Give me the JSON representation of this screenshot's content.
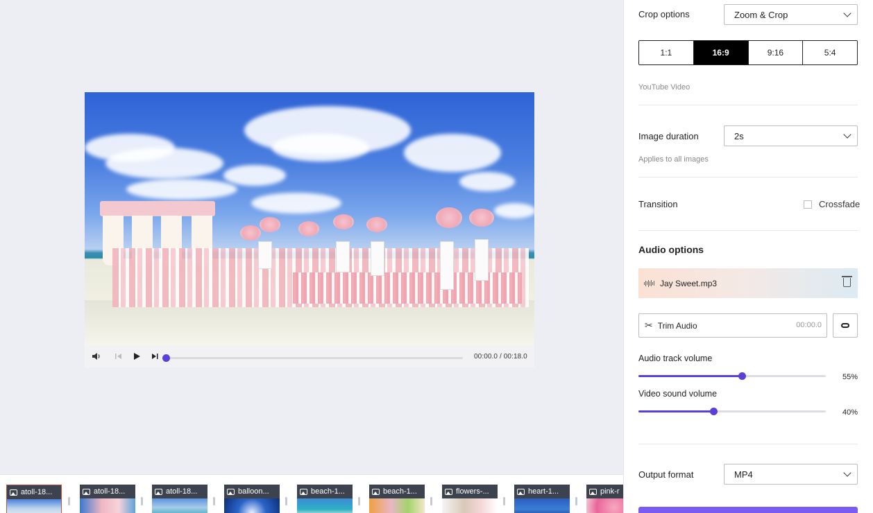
{
  "player": {
    "current_time": "00:00.0",
    "separator": "/",
    "duration": "00:18.0",
    "progress": 0.0
  },
  "filmstrip": {
    "items": [
      {
        "label": "atoll-18...",
        "selected": true
      },
      {
        "label": "atoll-18..."
      },
      {
        "label": "atoll-18..."
      },
      {
        "label": "balloon..."
      },
      {
        "label": "beach-1..."
      },
      {
        "label": "beach-1..."
      },
      {
        "label": "flowers-..."
      },
      {
        "label": "heart-1..."
      },
      {
        "label": "pink-r"
      }
    ]
  },
  "panel": {
    "crop": {
      "label": "Crop options",
      "value": "Zoom & Crop",
      "ratios": [
        "1:1",
        "16:9",
        "9:16",
        "5:4"
      ],
      "active_ratio": "16:9",
      "hint": "YouTube Video"
    },
    "duration": {
      "label": "Image duration",
      "value": "2s",
      "hint": "Applies to all images"
    },
    "transition": {
      "label": "Transition",
      "option": "Crossfade",
      "checked": false
    },
    "audio": {
      "heading": "Audio options",
      "file": "Jay Sweet.mp3",
      "trim_label": "Trim Audio",
      "trim_time": "00:00.0",
      "track_volume_label": "Audio track volume",
      "track_volume": "55%",
      "track_volume_value": 0.55,
      "video_volume_label": "Video sound volume",
      "video_volume": "40%",
      "video_volume_value": 0.4
    },
    "output": {
      "label": "Output format",
      "value": "MP4"
    }
  },
  "colors": {
    "accent": "#5b3fd6",
    "background": "#edeef4",
    "selected_thumb_border": "#c8553d"
  }
}
